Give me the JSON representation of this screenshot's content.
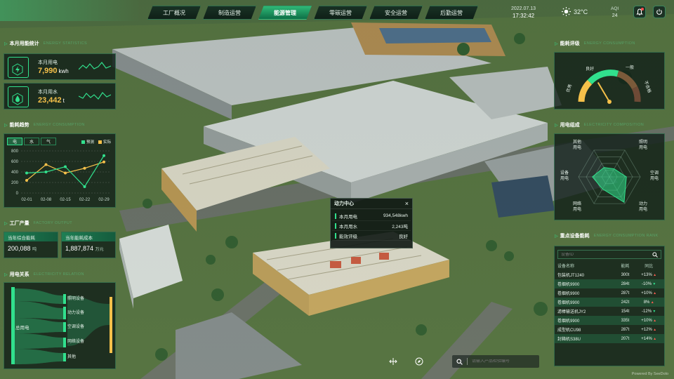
{
  "nav": {
    "tabs": [
      {
        "label": "工厂概况"
      },
      {
        "label": "制造运营"
      },
      {
        "label": "能源管理"
      },
      {
        "label": "零碳运营"
      },
      {
        "label": "安全运营"
      },
      {
        "label": "后勤运营"
      }
    ],
    "active_index": 2
  },
  "status": {
    "date": "2022.07.13",
    "time": "17:32:42",
    "temperature": "32°C",
    "aqi_label": "AQI",
    "aqi_value": "24"
  },
  "energy_stats": {
    "title": "本月用能统计",
    "title_en": "ENERGY STATISTICS",
    "electricity": {
      "label": "本月用电",
      "value": "7,990",
      "unit": "kwh",
      "icon": "lightning-icon"
    },
    "water": {
      "label": "本月用水",
      "value": "23,442",
      "unit": "t",
      "icon": "water-drop-icon"
    }
  },
  "energy_trend": {
    "title": "能耗趋势",
    "title_en": "ENERGY CONSUMPTION",
    "tabs": [
      "电",
      "水",
      "气"
    ],
    "active_tab": 0,
    "legend": {
      "forecast": "预测",
      "actual": "实际"
    }
  },
  "chart_data": {
    "type": "line",
    "categories": [
      "02-01",
      "02-08",
      "02-15",
      "02-22",
      "02-29"
    ],
    "yticks": [
      "800",
      "600",
      "400",
      "200",
      "0"
    ],
    "ylim": [
      0,
      800
    ],
    "series": [
      {
        "name": "预测",
        "values": [
          240,
          540,
          380,
          470,
          590
        ],
        "color": "#f5c04a"
      },
      {
        "name": "实际",
        "values": [
          380,
          400,
          500,
          120,
          710
        ],
        "color": "#31e08d"
      }
    ]
  },
  "production": {
    "title": "工厂产量",
    "title_en": "FACTORY OUTPUT",
    "cards": [
      {
        "label": "当年综合能耗",
        "value": "200,088",
        "unit": "吨"
      },
      {
        "label": "当年能耗成本",
        "value": "1,887,874",
        "unit": "万元"
      }
    ]
  },
  "power_relation": {
    "title": "用电关系",
    "title_en": "ELECTRICITY RELATION",
    "source": "总用电",
    "targets": [
      "照明设备",
      "动力设备",
      "空调设备",
      "网络设备",
      "其他"
    ]
  },
  "popup": {
    "title": "动力中心",
    "close": "×",
    "rows": [
      {
        "label": "本月用电",
        "value": "934,548kwh"
      },
      {
        "label": "本月用水",
        "value": "2,243吨"
      },
      {
        "label": "能效评级",
        "value": "良好"
      }
    ]
  },
  "rating": {
    "title": "能耗评级",
    "title_en": "ENERGY CONSUMPTION",
    "labels": [
      "优秀",
      "良好",
      "一般",
      "不合格"
    ],
    "level": 0.3
  },
  "composition": {
    "title": "用电组成",
    "title_en": "ELECTRICITY COMPOSITION",
    "axes": [
      "照明用电",
      "空调用电",
      "动力用电",
      "网络用电",
      "设备用电",
      "其他用电"
    ],
    "values": [
      0.3,
      0.55,
      0.95,
      0.45,
      0.55,
      0.35
    ]
  },
  "equipment": {
    "title": "重点设备能耗",
    "title_en": "ENERGY CONSUMPTION RANK",
    "search_placeholder": "设备ID",
    "columns": [
      "设备名称",
      "能耗",
      "同比"
    ],
    "rows": [
      {
        "name": "包装机JT1240",
        "value": "300t",
        "change": "+13%",
        "dir": "up"
      },
      {
        "name": "卷烟机9900",
        "value": "284t",
        "change": "-10%",
        "dir": "down"
      },
      {
        "name": "卷烟机9900",
        "value": "287t",
        "change": "+10%",
        "dir": "up"
      },
      {
        "name": "卷烟机9900",
        "value": "242t",
        "change": "8%",
        "dir": "up"
      },
      {
        "name": "滤棒输送机JY2",
        "value": "154t",
        "change": "-12%",
        "dir": "down"
      },
      {
        "name": "卷烟机9900",
        "value": "335t",
        "change": "+10%",
        "dir": "up"
      },
      {
        "name": "成型机CU98",
        "value": "287t",
        "change": "+12%",
        "dir": "up"
      },
      {
        "name": "封箱机S38U",
        "value": "207t",
        "change": "+14%",
        "dir": "up"
      }
    ]
  },
  "bottom": {
    "search_placeholder": "请输入产品检验编号",
    "credit": "Powered By SeeDolo"
  }
}
